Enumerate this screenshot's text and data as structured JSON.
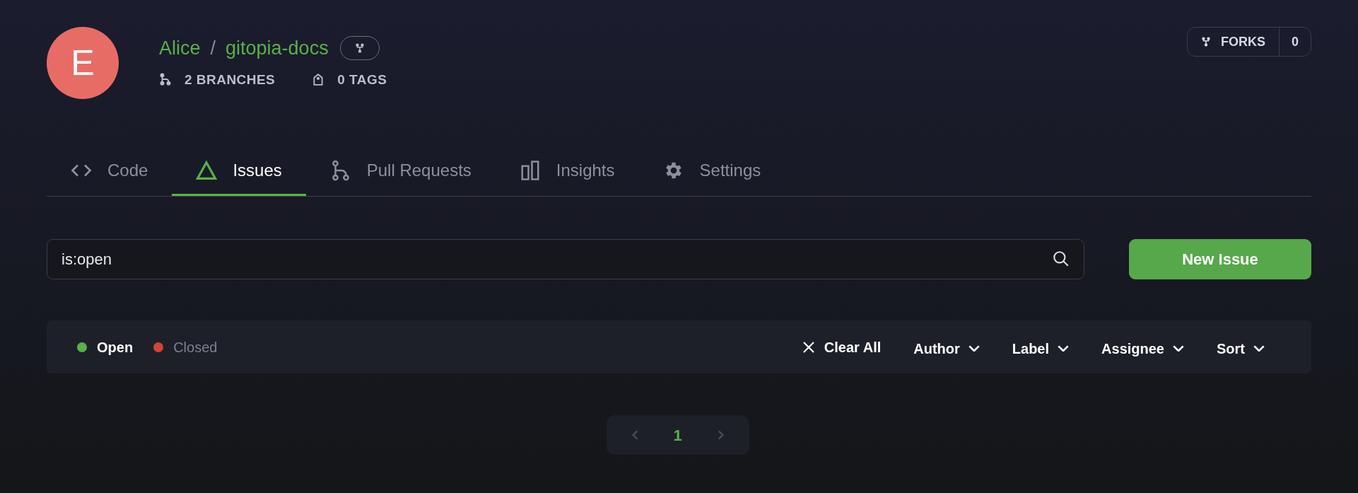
{
  "repo": {
    "avatar_letter": "E",
    "owner": "Alice",
    "separator": "/",
    "name": "gitopia-docs"
  },
  "stats": [
    {
      "kind": "branch",
      "label": "2 BRANCHES"
    },
    {
      "kind": "tag",
      "label": "0 TAGS"
    }
  ],
  "forks": {
    "label": "FORKS",
    "count": "0"
  },
  "tabs": [
    {
      "kind": "code",
      "label": "Code",
      "selected": false
    },
    {
      "kind": "issues",
      "label": "Issues",
      "selected": true
    },
    {
      "kind": "pulls",
      "label": "Pull Requests",
      "selected": false
    },
    {
      "kind": "insights",
      "label": "Insights",
      "selected": false
    },
    {
      "kind": "settings",
      "label": "Settings",
      "selected": false
    }
  ],
  "search": {
    "value": "is:open"
  },
  "new_issue_button": "New Issue",
  "state_filters": [
    {
      "label": "Open",
      "color": "#5ab04a",
      "selected": true
    },
    {
      "label": "Closed",
      "color": "#d2433a",
      "selected": false
    }
  ],
  "clear_all": "Clear All",
  "dropdowns": [
    "Author",
    "Label",
    "Assignee",
    "Sort"
  ],
  "pagination": {
    "current": "1"
  }
}
